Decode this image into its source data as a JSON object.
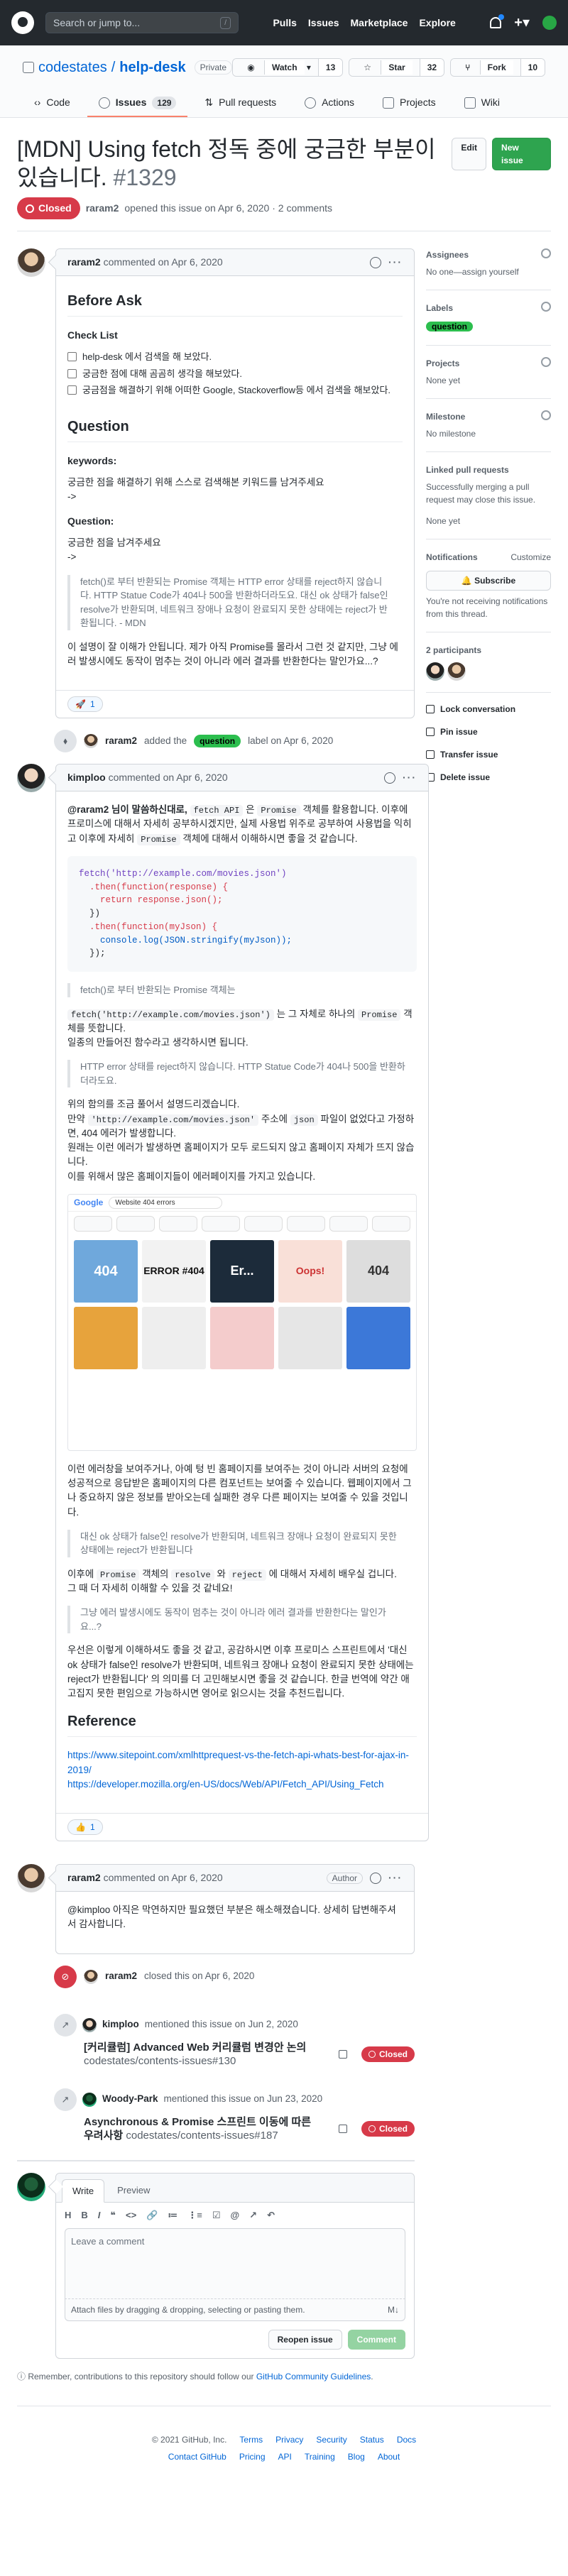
{
  "topbar": {
    "search_placeholder": "Search or jump to...",
    "search_hint": "/",
    "nav": [
      "Pulls",
      "Issues",
      "Marketplace",
      "Explore"
    ],
    "icons": [
      "github-logo-icon",
      "bell-icon",
      "plus-icon",
      "avatar"
    ]
  },
  "repo": {
    "owner": "codestates",
    "name": "help-desk",
    "visibility": "Private",
    "watch_label": "Watch",
    "watch_count": "13",
    "star_label": "Star",
    "star_count": "32",
    "fork_label": "Fork",
    "fork_count": "10",
    "tabs": [
      {
        "label": "Code",
        "icon": "code-icon"
      },
      {
        "label": "Issues",
        "icon": "issue-icon",
        "count": "129"
      },
      {
        "label": "Pull requests",
        "icon": "pull-request-icon"
      },
      {
        "label": "Actions",
        "icon": "play-icon"
      },
      {
        "label": "Projects",
        "icon": "project-icon"
      },
      {
        "label": "Wiki",
        "icon": "book-icon"
      }
    ]
  },
  "issue": {
    "title": "[MDN] Using fetch 정독 중에 궁금한 부분이 있습니다.",
    "number": "#1329",
    "edit_label": "Edit",
    "new_issue_label": "New issue",
    "state": "Closed",
    "opener": "raram2",
    "opened_text": "opened this issue on Apr 6, 2020 · 2 comments"
  },
  "comment1": {
    "author": "raram2",
    "when": "commented on Apr 6, 2020",
    "h_before": "Before Ask",
    "h_checklist": "Check List",
    "tasks": [
      "help-desk 에서 검색을 해 보았다.",
      "궁금한 점에 대해 곰곰히 생각을 해보았다.",
      "궁금점을 해결하기 위해 어떠한 Google, Stackoverflow등 에서 검색을 해보았다."
    ],
    "h_question": "Question",
    "keywords_label": "keywords:",
    "keywords_text": "궁금한 점을 해결하기 위해 스스로 검색해본 키워드를 남겨주세요",
    "arrow1": "->",
    "question_label": "Question:",
    "question_text": "궁금한 점을 남겨주세요",
    "arrow2": "->",
    "quote": "fetch()로 부터 반환되는 Promise 객체는 HTTP error 상태를 reject하지 않습니다. HTTP Statue Code가 404나 500을 반환하더라도요. 대신 ok 상태가 false인 resolve가 반환되며, 네트워크 장애나 요청이 완료되지 못한 상태에는 reject가 반환됩니다. - MDN",
    "para": "이 설명이 잘 이해가 안됩니다. 제가 아직 Promise를 몰라서 그런 것 같지만, 그냥 에러 발생시에도 동작이 멈추는 것이 아니라 에러 결과를 반환한다는 말인가요...?",
    "reaction_emoji": "🚀",
    "reaction_count": "1"
  },
  "event_label": {
    "actor": "raram2",
    "action": "added the",
    "label": "question",
    "suffix": "label on Apr 6, 2020"
  },
  "comment2": {
    "author": "kimploo",
    "when": "commented on Apr 6, 2020",
    "p1_a": "@raram2 님이 말씀하신대로,",
    "p1_code1": "fetch API",
    "p1_b": "은",
    "p1_code2": "Promise",
    "p1_c": "객체를 활용합니다. 이후에 프로미스에 대해서 자세히 공부하시겠지만, 실제 사용법 위주로 공부하여 사용법을 익히고 이후에 자세히",
    "p1_code3": "Promise",
    "p1_d": "객체에 대해서 이해하시면 좋을 것 같습니다.",
    "code_lines": [
      "fetch('http://example.com/movies.json')",
      "  .then(function(response) {",
      "    return response.json();",
      "  })",
      "  .then(function(myJson) {",
      "    console.log(JSON.stringify(myJson));",
      "  });"
    ],
    "quote1": "fetch()로 부터 반환되는 Promise 객체는",
    "p2_code1": "fetch('http://example.com/movies.json')",
    "p2_a": "는 그 자체로 하나의",
    "p2_code2": "Promise",
    "p2_b": "객체를 뜻합니다.",
    "p2_c": "일종의 만들어진 함수라고 생각하시면 됩니다.",
    "quote2": "HTTP error 상태를 reject하지 않습니다. HTTP Statue Code가 404나 500을 반환하더라도요.",
    "p3_a": "위의 함의를 조금 풀어서 설명드리겠습니다.",
    "p3_b": "만약",
    "p3_code1": "'http://example.com/movies.json'",
    "p3_c": "주소에",
    "p3_code2": "json",
    "p3_d": "파일이 없었다고 가정하면, 404 에러가 발생합니다.",
    "p3_e": "원래는 이런 에러가 발생하면 홈페이지가 모두 로드되지 않고 홈페이지 자체가 뜨지 않습니다.",
    "p3_f": "이를 위해서 많은 홈페이지들이 에러페이지를 가지고 있습니다.",
    "shot": {
      "search_brand": "Google",
      "search_query": "Website 404 errors",
      "tiles": [
        "404",
        "ERROR #404",
        "Er...",
        "Oops!",
        "404"
      ]
    },
    "p4": "이런 에러창을 보여주거나, 아예 텅 빈 홈페이지를 보여주는 것이 아니라 서버의 요청에 성공적으로 응답받은 홈페이지의 다른 컴포넌트는 보여줄 수 있습니다. 웹페이지에서 그나 중요하지 않은 정보를 받아오는데 실패한 경우 다른 페이지는 보여줄 수 있을 것입니다.",
    "quote3": "대신 ok 상태가 false인 resolve가 반환되며, 네트워크 장애나 요청이 완료되지 못한 상태에는 reject가 반환됩니다",
    "p5_a": "이후에",
    "p5_code1": "Promise",
    "p5_b": "객체의",
    "p5_code2": "resolve",
    "p5_c": "와",
    "p5_code3": "reject",
    "p5_d": "에 대해서 자세히 배우실 겁니다.",
    "p5_e": "그 때 더 자세히 이해할 수 있을 것 같네요!",
    "quote4": "그냥 에러 발생시에도 동작이 멈추는 것이 아니라 에러 결과를 반환한다는 말인가요...?",
    "p6": "우선은 이렇게 이해하셔도 좋을 것 같고, 공감하시면 이후 프로미스 스프린트에서 '대신 ok 상태가 false인 resolve가 반환되며, 네트워크 장애나 요청이 완료되지 못한 상태에는 reject가 반환됩니다' 의 의미를 더 고민해보시면 좋을 것 같습니다. 한글 번역에 약간 애고집지 못한 편임으로 가능하시면 영어로 읽으시는 것을 추천드립니다.",
    "h_reference": "Reference",
    "links": [
      "https://www.sitepoint.com/xmlhttprequest-vs-the-fetch-api-whats-best-for-ajax-in-2019/",
      "https://developer.mozilla.org/en-US/docs/Web/API/Fetch_API/Using_Fetch"
    ],
    "reaction_emoji": "👍",
    "reaction_count": "1"
  },
  "comment3": {
    "author": "raram2",
    "when": "commented on Apr 6, 2020",
    "badge": "Author",
    "text": "@kimploo 아직은 막연하지만 필요했던 부분은 해소해졌습니다. 상세히 답변해주셔서 감사합니다."
  },
  "event_closed": {
    "actor": "raram2",
    "text": "closed this on Apr 6, 2020"
  },
  "xrefs": [
    {
      "actor": "kimploo",
      "text": "mentioned this issue on Jun 2, 2020",
      "title": "[커리큘럼] Advanced Web 커리큘럼 변경안 논의",
      "ref": "codestates/contents-issues#130",
      "state": "Closed"
    },
    {
      "actor": "Woody-Park",
      "text": "mentioned this issue on Jun 23, 2020",
      "title": "Asynchronous & Promise 스프린트 이동에 따른 우려사항",
      "ref": "codestates/contents-issues#187",
      "state": "Closed"
    }
  ],
  "composer": {
    "tab_write": "Write",
    "tab_preview": "Preview",
    "toolbar": [
      "H",
      "B",
      "I",
      "❝",
      "<>",
      "🔗",
      "≔",
      "⋮≡",
      "☑",
      "@",
      "↗",
      "↶"
    ],
    "placeholder": "Leave a comment",
    "attach_text": "Attach files by dragging & dropping, selecting or pasting them.",
    "reopen_label": "Reopen issue",
    "comment_label": "Comment",
    "note_a": "Remember, contributions to this repository should follow our",
    "note_link": "GitHub Community Guidelines",
    "note_b": "."
  },
  "sidebar": {
    "assignees_title": "Assignees",
    "assignees_text": "No one—assign yourself",
    "labels_title": "Labels",
    "labels_value": "question",
    "projects_title": "Projects",
    "projects_text": "None yet",
    "milestone_title": "Milestone",
    "milestone_text": "No milestone",
    "linked_title": "Linked pull requests",
    "linked_text": "Successfully merging a pull request may close this issue.",
    "linked_none": "None yet",
    "notifications_title": "Notifications",
    "customize_label": "Customize",
    "subscribe_label": "Subscribe",
    "notif_text": "You're not receiving notifications from this thread.",
    "participants_title": "2 participants",
    "actions": [
      "Lock conversation",
      "Pin issue",
      "Transfer issue",
      "Delete issue"
    ]
  },
  "footer": {
    "copyright": "© 2021 GitHub, Inc.",
    "row1": [
      "Terms",
      "Privacy",
      "Security",
      "Status",
      "Docs"
    ],
    "row2": [
      "Contact GitHub",
      "Pricing",
      "API",
      "Training",
      "Blog",
      "About"
    ]
  },
  "colors": {
    "closed": "#d73a49",
    "label_question": "#2cbe4e",
    "link": "#0366d6",
    "tab_underline": "#f9826c"
  }
}
